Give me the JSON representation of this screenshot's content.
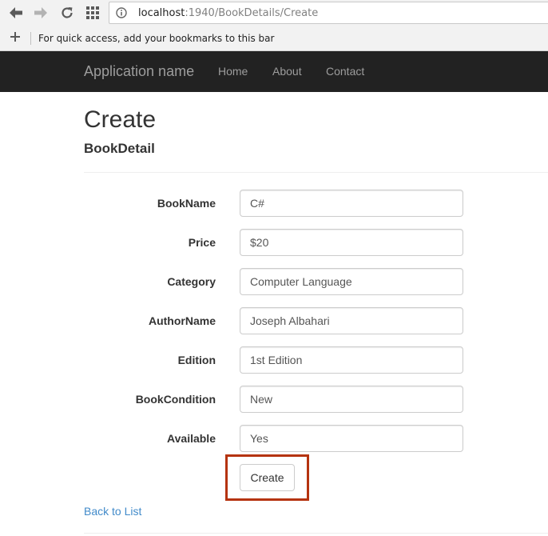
{
  "browser": {
    "url_host": "localhost",
    "url_path": ":1940/BookDetails/Create",
    "bookmarks_hint": "For quick access, add your bookmarks to this bar",
    "icons": [
      "back-arrow-icon",
      "forward-arrow-icon",
      "reload-icon",
      "apps-grid-icon",
      "page-info-icon",
      "plus-icon"
    ]
  },
  "navbar": {
    "brand": "Application name",
    "links": [
      "Home",
      "About",
      "Contact"
    ]
  },
  "page": {
    "title": "Create",
    "subtitle": "BookDetail"
  },
  "form": {
    "fields": [
      {
        "label": "BookName",
        "value": "C#"
      },
      {
        "label": "Price",
        "value": "$20"
      },
      {
        "label": "Category",
        "value": "Computer Language"
      },
      {
        "label": "AuthorName",
        "value": "Joseph Albahari"
      },
      {
        "label": "Edition",
        "value": "1st Edition"
      },
      {
        "label": "BookCondition",
        "value": "New"
      },
      {
        "label": "Available",
        "value": "Yes"
      }
    ],
    "submit_label": "Create"
  },
  "footer": {
    "back_link": "Back to List"
  },
  "colors": {
    "navbar_bg": "#222222",
    "nav_text": "#9d9d9d",
    "link": "#428bca",
    "highlight": "#b5330f"
  }
}
